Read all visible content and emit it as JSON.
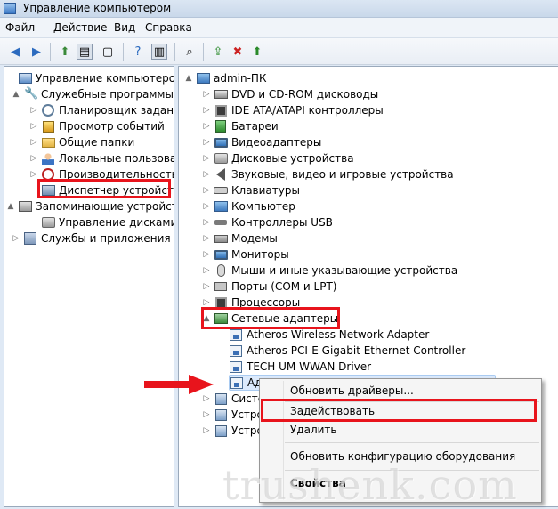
{
  "window": {
    "title": "Управление компьютером"
  },
  "menu": [
    "Файл",
    "Действие",
    "Вид",
    "Справка"
  ],
  "left_tree": [
    {
      "label": "Управление компьютером (л",
      "icon": "computer-management-icon",
      "arrow": ""
    },
    {
      "label": "Служебные программы",
      "icon": "tools-icon",
      "arrow": "▲"
    },
    {
      "label": "Планировщик заданий",
      "icon": "clock-icon",
      "arrow": "▷"
    },
    {
      "label": "Просмотр событий",
      "icon": "event-viewer-icon",
      "arrow": "▷"
    },
    {
      "label": "Общие папки",
      "icon": "shared-folder-icon",
      "arrow": "▷"
    },
    {
      "label": "Локальные пользовате",
      "icon": "users-icon",
      "arrow": "▷"
    },
    {
      "label": "Производительность",
      "icon": "performance-icon",
      "arrow": "▷"
    },
    {
      "label": "Диспетчер устройств",
      "icon": "device-manager-icon",
      "arrow": ""
    },
    {
      "label": "Запоминающие устройст",
      "icon": "storage-icon",
      "arrow": "▲"
    },
    {
      "label": "Управление дисками",
      "icon": "disk-management-icon",
      "arrow": ""
    },
    {
      "label": "Службы и приложения",
      "icon": "services-icon",
      "arrow": "▷"
    }
  ],
  "right_tree": {
    "root": "admin-ПК",
    "items": [
      {
        "label": "DVD и CD-ROM дисководы",
        "icon": "dvd-drive-icon"
      },
      {
        "label": "IDE ATA/ATAPI контроллеры",
        "icon": "ide-controller-icon"
      },
      {
        "label": "Батареи",
        "icon": "battery-icon"
      },
      {
        "label": "Видеоадаптеры",
        "icon": "display-adapter-icon"
      },
      {
        "label": "Дисковые устройства",
        "icon": "disk-drive-icon"
      },
      {
        "label": "Звуковые, видео и игровые устройства",
        "icon": "speaker-icon"
      },
      {
        "label": "Клавиатуры",
        "icon": "keyboard-icon"
      },
      {
        "label": "Компьютер",
        "icon": "computer-icon"
      },
      {
        "label": "Контроллеры USB",
        "icon": "usb-icon"
      },
      {
        "label": "Модемы",
        "icon": "modem-icon"
      },
      {
        "label": "Мониторы",
        "icon": "monitor-icon"
      },
      {
        "label": "Мыши и иные указывающие устройства",
        "icon": "mouse-icon"
      },
      {
        "label": "Порты (COM и LPT)",
        "icon": "port-icon"
      },
      {
        "label": "Процессоры",
        "icon": "processor-icon"
      },
      {
        "label": "Сетевые адаптеры",
        "icon": "network-adapter-icon"
      }
    ],
    "network_children": [
      "Atheros  Wireless Network Adapter",
      "Atheros PCI-E Gigabit Ethernet Controller",
      "TECH UM WWAN Driver",
      "Ад"
    ],
    "after": [
      "Систе",
      "Устро",
      "Устро"
    ]
  },
  "context_menu": {
    "update": "Обновить драйверы...",
    "enable": "Задействовать",
    "delete": "Удалить",
    "scan": "Обновить конфигурацию оборудования",
    "properties": "Свойства"
  },
  "watermark": "trushenk.com",
  "colors": {
    "highlight": "#e8141c",
    "accent": "#3c70b5"
  }
}
